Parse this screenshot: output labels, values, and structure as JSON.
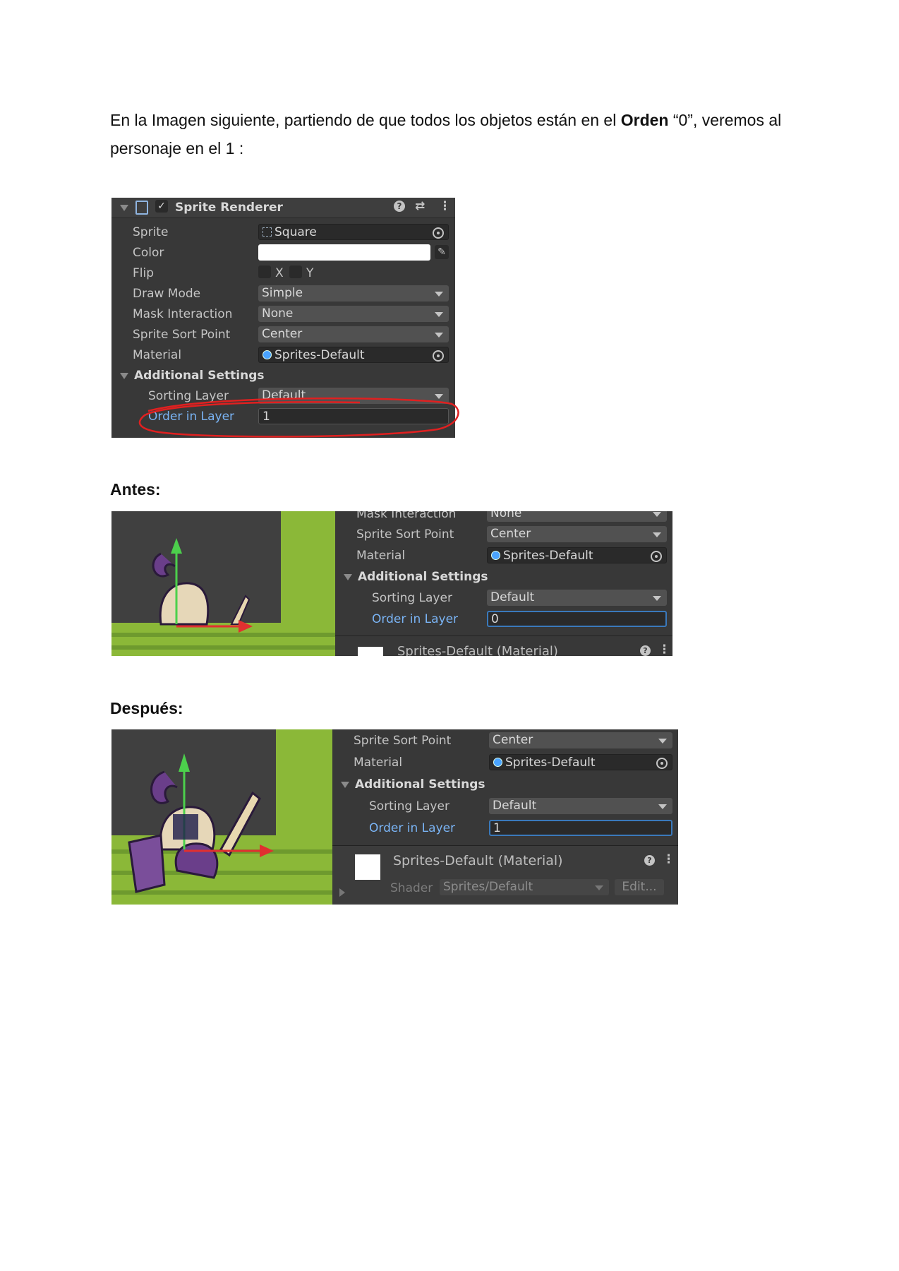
{
  "intro": {
    "part1": "En la  Imagen siguiente, partiendo de que todos los objetos están en el ",
    "bold": "Orden",
    "part2": " “0”, veremos al personaje en el 1 :"
  },
  "panel1": {
    "title": "Sprite Renderer",
    "rows": {
      "sprite": {
        "label": "Sprite",
        "value": "Square"
      },
      "color": {
        "label": "Color"
      },
      "flip": {
        "label": "Flip",
        "x": "X",
        "y": "Y"
      },
      "draw_mode": {
        "label": "Draw Mode",
        "value": "Simple"
      },
      "mask_interaction": {
        "label": "Mask Interaction",
        "value": "None"
      },
      "sort_point": {
        "label": "Sprite Sort Point",
        "value": "Center"
      },
      "material": {
        "label": "Material",
        "value": "Sprites-Default"
      },
      "additional": {
        "label": "Additional Settings"
      },
      "sorting_layer": {
        "label": "Sorting Layer",
        "value": "Default"
      },
      "order": {
        "label": "Order in Layer",
        "value": "1"
      }
    }
  },
  "antes": {
    "heading": "Antes:",
    "mask_label": "Mask Interaction",
    "mask_value": "None",
    "sort_label": "Sprite Sort Point",
    "sort_value": "Center",
    "material_label": "Material",
    "material_value": "Sprites-Default",
    "additional": "Additional Settings",
    "sorting_label": "Sorting Layer",
    "sorting_value": "Default",
    "order_label": "Order in Layer",
    "order_value": "0",
    "footer": "Sprites-Default (Material)"
  },
  "despues": {
    "heading": "Después:",
    "sort_label": "Sprite Sort Point",
    "sort_value": "Center",
    "material_label": "Material",
    "material_value": "Sprites-Default",
    "additional": "Additional Settings",
    "sorting_label": "Sorting Layer",
    "sorting_value": "Default",
    "order_label": "Order in Layer",
    "order_value": "1",
    "material_title": "Sprites-Default (Material)",
    "shader_label": "Shader",
    "shader_value": "Sprites/Default",
    "edit_label": "Edit..."
  },
  "colors": {
    "panel_bg": "#383838",
    "highlight_blue": "#7ab4f5",
    "annotation_red": "#e02020",
    "grass": "#8bb838"
  }
}
